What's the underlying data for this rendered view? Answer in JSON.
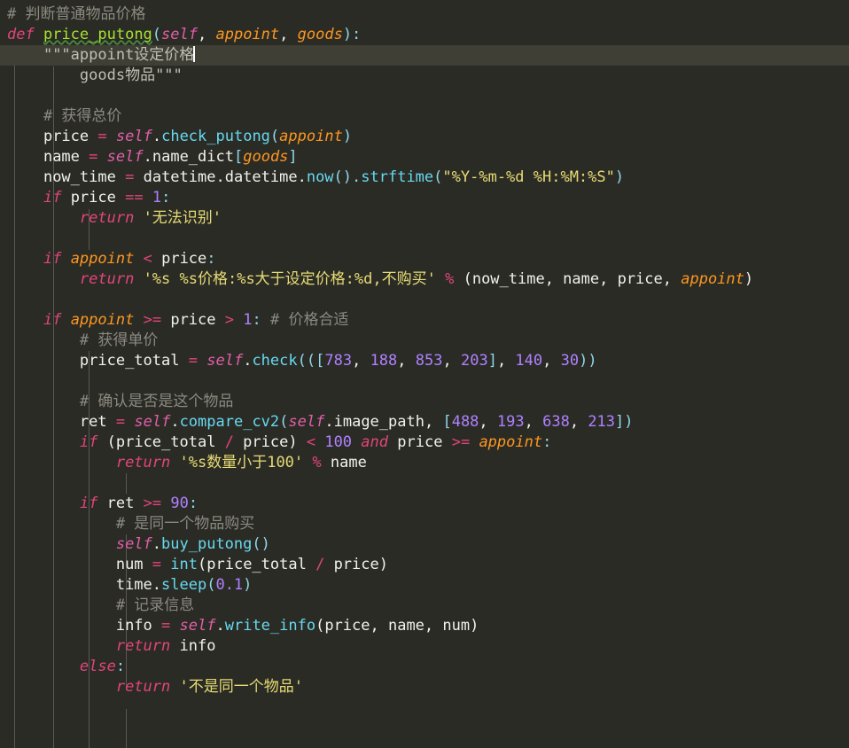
{
  "editor": {
    "language": "Python",
    "background_color": "#2b2b26",
    "current_line_color": "#3f3f36",
    "font_size_px": 17,
    "line_height_px": 23,
    "caret_line_index": 2,
    "colors": {
      "comment": "#8a8a80",
      "keyword": "#e0457b",
      "function_def": "#a6e22e",
      "function_call": "#66d9ef",
      "self": "#e05fa8",
      "parameter": "#fd971f",
      "string": "#e6db74",
      "number": "#ae81ff",
      "operator": "#e0457b",
      "plain_text": "#f2f2ec",
      "punctuation": "#8fd7e8",
      "docstring": "#bfbfb5",
      "indent_guide": "#5a5a52",
      "caret": "#ffffff"
    }
  },
  "code": {
    "line_01_comment": "# 判断普通物品价格",
    "line_02_def_kw": "def",
    "line_02_name": "price_putong",
    "line_02_open": "(",
    "line_02_self": "self",
    "line_02_comma1": ", ",
    "line_02_p1": "appoint",
    "line_02_comma2": ", ",
    "line_02_p2": "goods",
    "line_02_close": "):",
    "line_03_doc": "\"\"\"appoint设定价格",
    "line_04_doc": "goods物品\"\"\"",
    "line_06_comment": "# 获得总价",
    "line_07_var": "price",
    "line_07_eq": "=",
    "line_07_self": "self",
    "line_07_dot": ".",
    "line_07_call": "check_putong",
    "line_07_open": "(",
    "line_07_arg": "appoint",
    "line_07_close": ")",
    "line_08_var": "name",
    "line_08_eq": "=",
    "line_08_self": "self",
    "line_08_dot": ".",
    "line_08_attr": "name_dict",
    "line_08_open": "[",
    "line_08_key": "goods",
    "line_08_close": "]",
    "line_09_var": "now_time",
    "line_09_eq": "=",
    "line_09_mod": "datetime.datetime.",
    "line_09_now": "now",
    "line_09_nowparen": "().",
    "line_09_strftime": "strftime",
    "line_09_open": "(",
    "line_09_str": "\"%Y-%m-%d %H:%M:%S\"",
    "line_09_close": ")",
    "line_10_if": "if",
    "line_10_var": "price",
    "line_10_op": "==",
    "line_10_num": "1",
    "line_10_colon": ":",
    "line_11_return": "return",
    "line_11_str": "'无法识别'",
    "line_13_if": "if",
    "line_13_param": "appoint",
    "line_13_op": "<",
    "line_13_var": "price",
    "line_13_colon": ":",
    "line_14_return": "return",
    "line_14_str": "'%s %s价格:%s大于设定价格:%d,不购买'",
    "line_14_pct": "%",
    "line_14_tuple_open": " (now_time, name, price, ",
    "line_14_param": "appoint",
    "line_14_tuple_close": ")",
    "line_16_if": "if",
    "line_16_param": "appoint",
    "line_16_op1": ">=",
    "line_16_var": "price",
    "line_16_op2": ">",
    "line_16_num": "1",
    "line_16_colon": ":",
    "line_16_comment": "# 价格合适",
    "line_17_comment": "# 获得单价",
    "line_18_var": "price_total",
    "line_18_eq": "=",
    "line_18_self": "self",
    "line_18_dot": ".",
    "line_18_call": "check",
    "line_18_open": "((",
    "line_18_lb": "[",
    "line_18_n1": "783",
    "line_18_n2": "188",
    "line_18_n3": "853",
    "line_18_n4": "203",
    "line_18_rb": "]",
    "line_18_n5": "140",
    "line_18_n6": "30",
    "line_18_close": "))",
    "line_20_comment": "# 确认是否是这个物品",
    "line_21_var": "ret",
    "line_21_eq": "=",
    "line_21_self": "self",
    "line_21_dot": ".",
    "line_21_call": "compare_cv2",
    "line_21_open": "(",
    "line_21_self2": "self",
    "line_21_dot2": ".",
    "line_21_attr": "image_path",
    "line_21_comma": ", ",
    "line_21_lb": "[",
    "line_21_n1": "488",
    "line_21_n2": "193",
    "line_21_n3": "638",
    "line_21_n4": "213",
    "line_21_rb": "]",
    "line_21_close": ")",
    "line_22_if": "if",
    "line_22_expr": "(price_total ",
    "line_22_slash": "/",
    "line_22_expr2": " price) ",
    "line_22_lt": "<",
    "line_22_num": "100",
    "line_22_and": "and",
    "line_22_var": "price",
    "line_22_ge": ">=",
    "line_22_param": "appoint",
    "line_22_colon": ":",
    "line_23_return": "return",
    "line_23_str": "'%s数量小于100'",
    "line_23_pct": "%",
    "line_23_var": "name",
    "line_25_if": "if",
    "line_25_var": "ret",
    "line_25_op": ">=",
    "line_25_num": "90",
    "line_25_colon": ":",
    "line_26_comment": "# 是同一个物品购买",
    "line_27_self": "self",
    "line_27_dot": ".",
    "line_27_call": "buy_putong",
    "line_27_parens": "()",
    "line_28_var": "num",
    "line_28_eq": "=",
    "line_28_int": "int",
    "line_28_open": "(price_total ",
    "line_28_slash": "/",
    "line_28_close": " price)",
    "line_29_mod": "time.",
    "line_29_call": "sleep",
    "line_29_open": "(",
    "line_29_num": "0.1",
    "line_29_close": ")",
    "line_30_comment": "# 记录信息",
    "line_31_var": "info",
    "line_31_eq": "=",
    "line_31_self": "self",
    "line_31_dot": ".",
    "line_31_call": "write_info",
    "line_31_args": "(price, name, num)",
    "line_32_return": "return",
    "line_32_var": "info",
    "line_33_else": "else",
    "line_33_colon": ":",
    "line_34_return": "return",
    "line_34_str": "'不是同一个物品'"
  }
}
